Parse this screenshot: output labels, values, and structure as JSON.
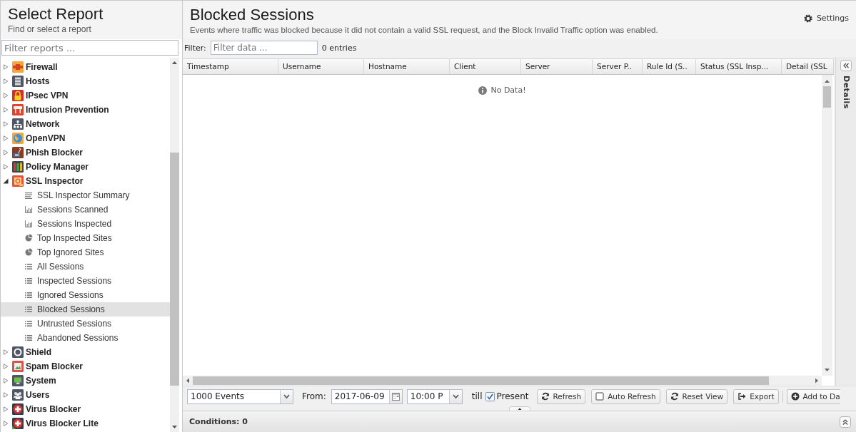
{
  "left_panel": {
    "title": "Select Report",
    "subtitle": "Find or select a report",
    "filter": {
      "placeholder": "Filter reports ..."
    }
  },
  "report_tree": [
    {
      "label": "Firewall",
      "kind": "firewall",
      "expanded": false,
      "selected": false
    },
    {
      "label": "Hosts",
      "kind": "hosts",
      "expanded": false,
      "selected": false
    },
    {
      "label": "IPsec VPN",
      "kind": "lock",
      "expanded": false,
      "selected": false
    },
    {
      "label": "Intrusion Prevention",
      "kind": "intrusion",
      "expanded": false,
      "selected": false
    },
    {
      "label": "Network",
      "kind": "network",
      "expanded": false,
      "selected": false
    },
    {
      "label": "OpenVPN",
      "kind": "globe",
      "expanded": false,
      "selected": false
    },
    {
      "label": "Phish Blocker",
      "kind": "phish",
      "expanded": false,
      "selected": false
    },
    {
      "label": "Policy Manager",
      "kind": "policy",
      "expanded": false,
      "selected": false
    },
    {
      "label": "SSL Inspector",
      "kind": "ssl",
      "expanded": true,
      "selected": false,
      "children": [
        {
          "label": "SSL Inspector Summary",
          "kind": "summary",
          "selected": false
        },
        {
          "label": "Sessions Scanned",
          "kind": "bar",
          "selected": false
        },
        {
          "label": "Sessions Inspected",
          "kind": "bar",
          "selected": false
        },
        {
          "label": "Top Inspected Sites",
          "kind": "pie",
          "selected": false
        },
        {
          "label": "Top Ignored Sites",
          "kind": "pie",
          "selected": false
        },
        {
          "label": "All Sessions",
          "kind": "list",
          "selected": false
        },
        {
          "label": "Inspected Sessions",
          "kind": "list",
          "selected": false
        },
        {
          "label": "Ignored Sessions",
          "kind": "list",
          "selected": false
        },
        {
          "label": "Blocked Sessions",
          "kind": "list",
          "selected": true
        },
        {
          "label": "Untrusted Sessions",
          "kind": "list",
          "selected": false
        },
        {
          "label": "Abandoned Sessions",
          "kind": "list",
          "selected": false
        }
      ]
    },
    {
      "label": "Shield",
      "kind": "shield",
      "expanded": false,
      "selected": false
    },
    {
      "label": "Spam Blocker",
      "kind": "spam",
      "expanded": false,
      "selected": false
    },
    {
      "label": "System",
      "kind": "system",
      "expanded": false,
      "selected": false
    },
    {
      "label": "Users",
      "kind": "users",
      "expanded": false,
      "selected": false
    },
    {
      "label": "Virus Blocker",
      "kind": "virus",
      "expanded": false,
      "selected": false
    },
    {
      "label": "Virus Blocker Lite",
      "kind": "viruslite",
      "expanded": false,
      "selected": false
    }
  ],
  "report": {
    "title": "Blocked Sessions",
    "description": "Events where traffic was blocked because it did not contain a valid SSL request, and the Block Invalid Traffic option was enabled.",
    "settings": "Settings"
  },
  "filter_bar": {
    "label": "Filter:",
    "placeholder": "Filter data ...",
    "count": "0 entries"
  },
  "grid": {
    "columns": [
      "Timestamp",
      "Username",
      "Hostname",
      "Client",
      "Server",
      "Server P..",
      "Rule Id (S..",
      "Status (SSL Insp...",
      "Detail (SSL"
    ],
    "empty_message": "No Data!"
  },
  "details_panel": {
    "label": "Details"
  },
  "toolbar": {
    "events": "1000 Events",
    "from_label": "From:",
    "date": "2017-06-09",
    "time": "10:00 P",
    "till_label": "till",
    "present": {
      "label": "Present",
      "checked": true
    },
    "refresh": "Refresh",
    "auto_refresh": {
      "label": "Auto Refresh",
      "checked": false
    },
    "reset_view": "Reset View",
    "export": "Export",
    "add_button": "Add to Da"
  },
  "conditions": {
    "label": "Conditions: 0"
  }
}
